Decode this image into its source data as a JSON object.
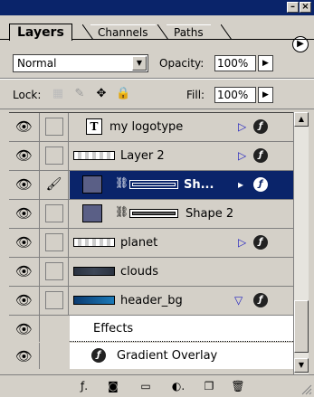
{
  "window": {
    "minimize_label": "–",
    "close_label": "×"
  },
  "tabs": [
    {
      "label": "Layers"
    },
    {
      "label": "Channels"
    },
    {
      "label": "Paths"
    }
  ],
  "blend": {
    "mode": "Normal",
    "opacity_label": "Opacity:",
    "opacity": "100%"
  },
  "lock": {
    "label": "Lock:",
    "fill_label": "Fill:",
    "fill": "100%"
  },
  "layers": [
    {
      "name": "my logotype",
      "type": "text",
      "has_fx": true,
      "fx_expanded": false
    },
    {
      "name": "Layer 2",
      "type": "pattern",
      "has_fx": true,
      "fx_expanded": false
    },
    {
      "name": "Sh...",
      "type": "shape",
      "has_fx": true,
      "fx_expanded": false,
      "selected": true
    },
    {
      "name": "Shape 2",
      "type": "shape",
      "has_fx": false
    },
    {
      "name": "planet",
      "type": "pattern",
      "has_fx": true,
      "fx_expanded": false
    },
    {
      "name": "clouds",
      "type": "dark",
      "has_fx": false
    },
    {
      "name": "header_bg",
      "type": "gradient",
      "has_fx": true,
      "fx_expanded": true
    }
  ],
  "effects": {
    "label": "Effects",
    "items": [
      "Gradient Overlay"
    ]
  },
  "icons": {
    "eye": "eye-icon",
    "brush": "brush-icon",
    "fx": "layer-style-icon",
    "text_type": "T"
  },
  "colors": {
    "selection": "#0a246a",
    "panel": "#d4d0c8"
  }
}
